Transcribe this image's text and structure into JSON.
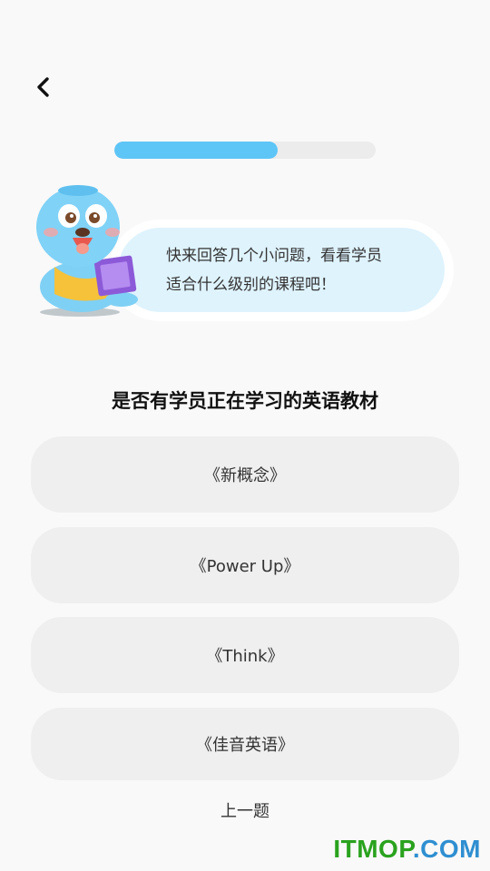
{
  "nav": {
    "back_icon": "chevron-left-icon"
  },
  "progress": {
    "value_percent": 62.5,
    "color": "#5ec5f7"
  },
  "mascot": {
    "icon": "seal-mascot-reading-book"
  },
  "bubble": {
    "line1": "快来回答几个小问题，看看学员",
    "line2": "适合什么级别的课程吧！"
  },
  "question": "是否有学员正在学习的英语教材",
  "options": [
    {
      "label": "《新概念》"
    },
    {
      "label": "《Power Up》"
    },
    {
      "label": "《Think》"
    },
    {
      "label": "《佳音英语》"
    }
  ],
  "footer": {
    "prev_label": "上一题"
  },
  "watermark": {
    "text_green": "ITMOP",
    "text_blue": ".COM"
  }
}
